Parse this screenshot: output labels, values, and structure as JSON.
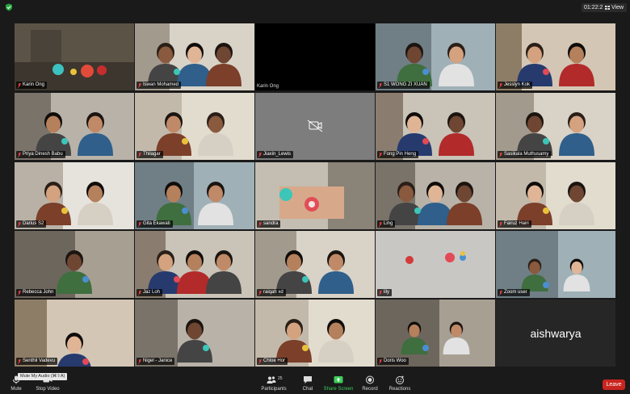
{
  "topbar": {
    "timer": "01:22:26",
    "view_label": "View"
  },
  "participants": [
    {
      "name": "Karin Ong",
      "speaking": true,
      "scene": "objects"
    },
    {
      "name": "Iswan Mohamed",
      "scene": "family-three"
    },
    {
      "name": "Karin Ong",
      "scene": "blank"
    },
    {
      "name": "S1 WONG ZI XUAN",
      "scene": "two-people"
    },
    {
      "name": "Jesslyn Kok",
      "scene": "two-people-selfie"
    },
    {
      "name": "Priya Dinesh Babu",
      "scene": "two-people"
    },
    {
      "name": "Thilagar",
      "scene": "two-people"
    },
    {
      "name": "Jiaxin_Lewis",
      "scene": "camera-off"
    },
    {
      "name": "Fong Pin Heng",
      "scene": "two-people"
    },
    {
      "name": "Sasikala Muthusamy",
      "scene": "two-people"
    },
    {
      "name": "Darius S2",
      "scene": "two-people"
    },
    {
      "name": "Gita Ekawati",
      "scene": "two-people"
    },
    {
      "name": "sandra",
      "scene": "hand-objects"
    },
    {
      "name": "Ling",
      "scene": "family-three"
    },
    {
      "name": "Fairuz Hairi",
      "scene": "two-people"
    },
    {
      "name": "Rebecca John",
      "scene": "one-person"
    },
    {
      "name": "Jaz Loh",
      "scene": "family-three"
    },
    {
      "name": "raiqah xd",
      "scene": "two-people"
    },
    {
      "name": "lily",
      "scene": "table-objects"
    },
    {
      "name": "Zoom user",
      "scene": "two-people-far"
    },
    {
      "name": "Senthil Vadevu",
      "scene": "one-person-low"
    },
    {
      "name": "Nigel - Janice",
      "scene": "one-person-center"
    },
    {
      "name": "Chloe Hor",
      "scene": "two-people"
    },
    {
      "name": "Doris Woo",
      "scene": "two-people-small"
    },
    {
      "name": "aishwarya",
      "scene": "name-only"
    }
  ],
  "toolbar": {
    "mute_label": "Mute",
    "tooltip": "Mute My Audio (⌘⇧A)",
    "stop_video_label": "Stop Video",
    "participants_label": "Participants",
    "participants_count": "25",
    "chat_label": "Chat",
    "share_screen_label": "Share Screen",
    "record_label": "Record",
    "reactions_label": "Reactions",
    "leave_label": "Leave"
  },
  "colors": {
    "speaker_outline": "#e4e065",
    "share_green": "#3ccf5b",
    "leave_red": "#c8251f"
  }
}
